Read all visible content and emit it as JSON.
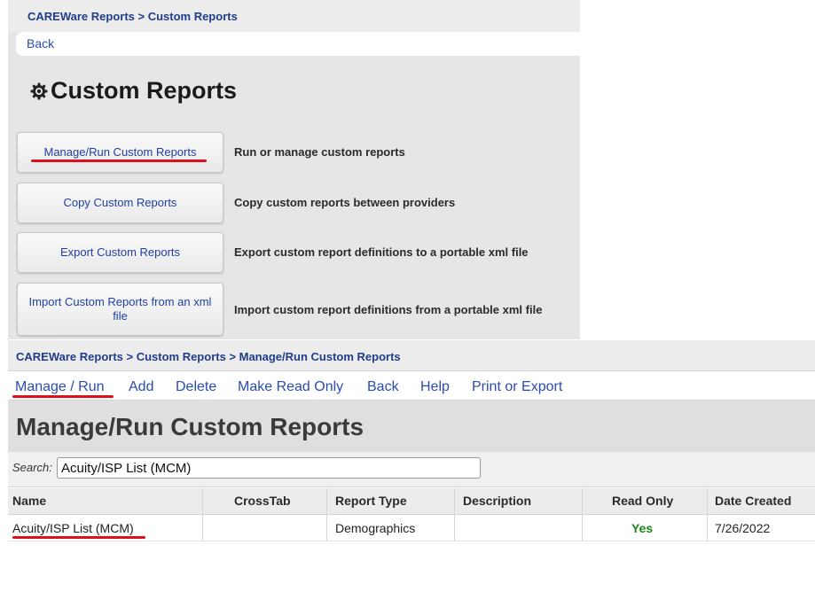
{
  "top": {
    "breadcrumb": "CAREWare Reports >  Custom Reports",
    "back_label": "Back",
    "title": "Custom Reports",
    "actions": [
      {
        "label": "Manage/Run Custom Reports",
        "description": "Run or manage custom reports"
      },
      {
        "label": "Copy Custom Reports",
        "description": "Copy custom reports between providers"
      },
      {
        "label": "Export Custom Reports",
        "description": "Export custom report definitions to a portable xml file"
      },
      {
        "label": "Import Custom Reports from an xml file",
        "description": "Import custom report definitions from a portable xml file"
      }
    ]
  },
  "bottom": {
    "breadcrumb": "CAREWare Reports >  Custom Reports >  Manage/Run Custom Reports",
    "toolbar": {
      "manage_run": "Manage / Run",
      "add": "Add",
      "delete": "Delete",
      "make_read_only": "Make Read Only",
      "back": "Back",
      "help": "Help",
      "print_export": "Print or Export"
    },
    "title": "Manage/Run Custom Reports",
    "search": {
      "label": "Search:",
      "value": "Acuity/ISP List (MCM)"
    },
    "columns": [
      "Name",
      "CrossTab",
      "Report Type",
      "Description",
      "Read Only",
      "Date Created"
    ],
    "rows": [
      {
        "name": "Acuity/ISP List (MCM)",
        "crosstab": "",
        "report_type": "Demographics",
        "description": "",
        "read_only": "Yes",
        "date_created": "7/26/2022"
      }
    ]
  },
  "colors": {
    "link": "#2b4bb0",
    "annotation": "#e0101a",
    "yes": "#1a8a1a"
  },
  "icons": {
    "title_icon": "gear-icon"
  }
}
